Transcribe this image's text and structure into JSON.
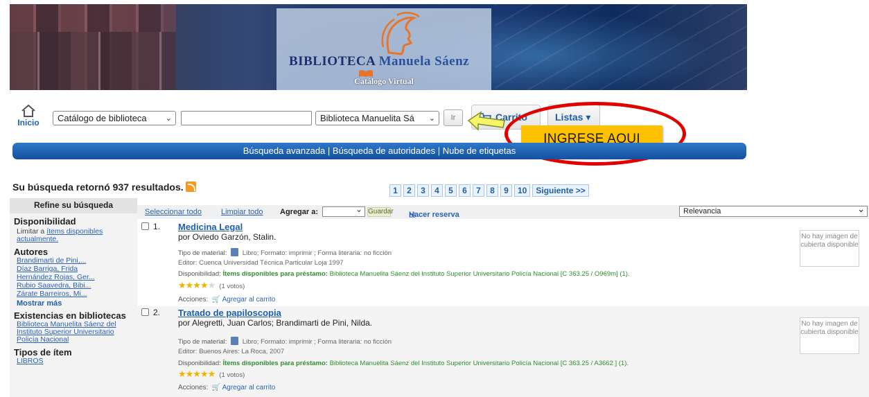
{
  "banner": {
    "title_part1": "BIBLIOTECA",
    "title_part2": "Manuela Sáenz",
    "subtitle": "Catálogo Virtual"
  },
  "search": {
    "home_label": "Inicio",
    "catalog_select_value": "Catálogo de biblioteca",
    "query_value": "",
    "branch_select_value": "Biblioteca Manuelita Sá",
    "go_label": "Ir",
    "cart_label": "Carrito",
    "lists_label": "Listas ▾"
  },
  "annotation": {
    "label": "INGRESE AQUI",
    "color": "#e00000",
    "box_color": "#ffc000"
  },
  "navbar": {
    "links": [
      "Búsqueda avanzada",
      "Búsqueda de autoridades",
      "Nube de etiquetas"
    ]
  },
  "results": {
    "count_text": "Su búsqueda retornó 937 resultados.",
    "pages": [
      "1",
      "2",
      "3",
      "4",
      "5",
      "6",
      "7",
      "8",
      "9",
      "10"
    ],
    "next_label": "Siguiente >>"
  },
  "sidebar": {
    "refine_title": "Refine su búsqueda",
    "availability_heading": "Disponibilidad",
    "availability_prefix": "Limitar a",
    "availability_link": "ítems disponibles actualmente.",
    "authors_heading": "Autores",
    "authors": [
      "Brandimarti de Pini,...",
      "Díaz Barriga, Frida",
      "Hernández Rojas, Ger...",
      "Rubio Saavedra, Bibi...",
      "Zárate Barreiros, Mi..."
    ],
    "show_more": "Mostrar más",
    "holdings_heading": "Existencias en bibliotecas",
    "holdings_link": "Biblioteca Manuelita Sáenz del Instituto Superior Universitario Policía Nacional",
    "item_types_heading": "Tipos de ítem",
    "item_type_first": "LIBROS"
  },
  "toolbar": {
    "select_all": "Seleccionar todo",
    "clear_all": "Limpiar todo",
    "add_to": "Agregar a:",
    "save": "Guardar",
    "hold": "Hacer reserva",
    "sort_value": "Relevancia"
  },
  "items": [
    {
      "number": "1.",
      "title": "Medicina Legal",
      "author": "por Oviedo Garzón, Stalin.",
      "material_label": "Tipo de material:",
      "material_value": "Libro; Formato: imprimir ; Forma literaria: no ficción",
      "publisher": "Editor: Cuenca Universidad Técnica Particular Loja 1997",
      "availability_label": "Disponibilidad:",
      "availability_bold": "Ítems disponibles para préstamo:",
      "availability_text": "Biblioteca Manuelita Sáenz del Instituto Superior Universitario Policía Nacional [C 363.25 / O969m] (1).",
      "rating": 4,
      "votes": "(1 votos)",
      "actions_label": "Acciones:",
      "add_cart": "Agregar al carrito",
      "cover_text": "No hay imagen de cubierta disponible"
    },
    {
      "number": "2.",
      "title": "Tratado de papiloscopia",
      "author": "por Alegretti, Juan Carlos; Brandimarti de Pini, Nilda.",
      "material_label": "Tipo de material:",
      "material_value": "Libro; Formato: imprimir ; Forma literaria: no ficción",
      "publisher": "Editor: Buenos Aires: La Roca, 2007",
      "availability_label": "Disponibilidad:",
      "availability_bold": "Ítems disponibles para préstamo:",
      "availability_text": "Biblioteca Manuelita Sáenz del Instituto Superior Universitario Policía Nacional [C 363.25 / A3662 ] (1).",
      "rating": 5,
      "votes": "(1 votos)",
      "actions_label": "Acciones:",
      "add_cart": "Agregar al carrito",
      "cover_text": "No hay imagen de cubierta disponible"
    }
  ]
}
